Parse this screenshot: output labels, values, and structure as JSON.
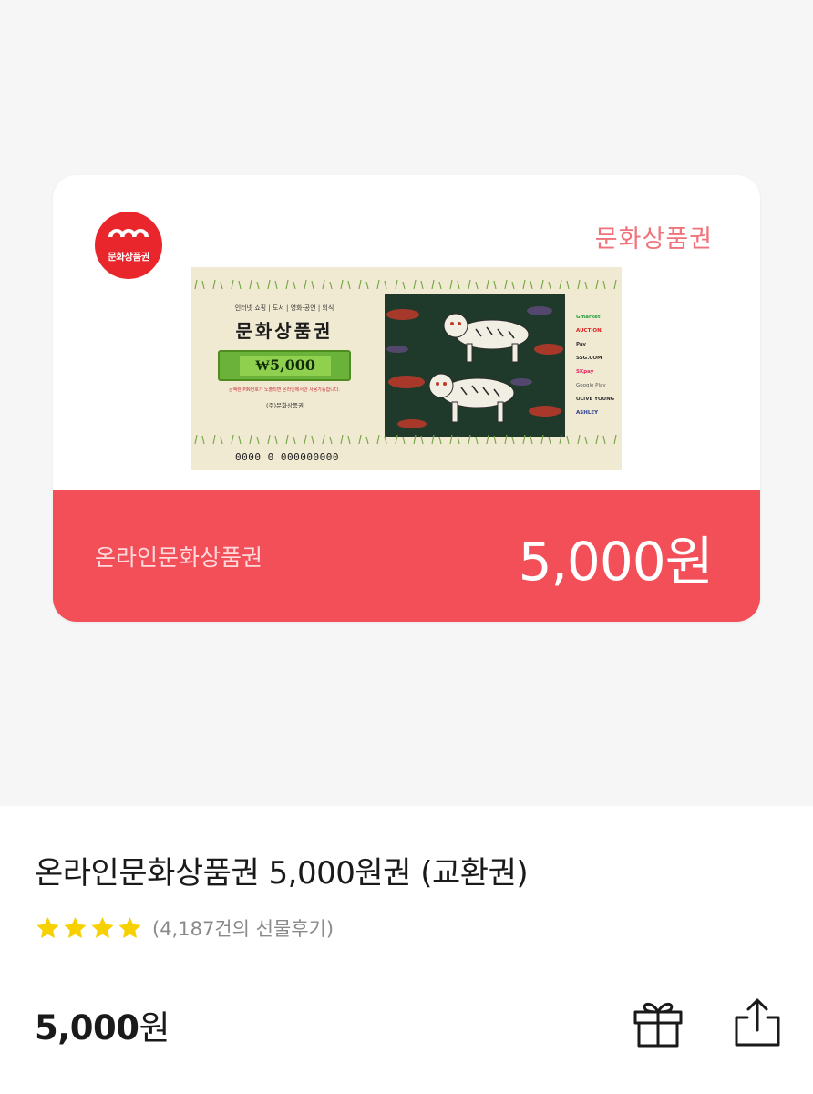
{
  "card": {
    "brand_logo_text": "문화상품권",
    "title": "문화상품권",
    "label": "온라인문화상품권",
    "amount": "5,000원",
    "voucher": {
      "uses": "인터넷 쇼핑 | 도서 | 영화·공연 | 외식",
      "title": "문화상품권",
      "amount": "₩5,000",
      "fine_print": "금액란 PIN번호가 노출되면 온라인에서만 사용가능합니다.",
      "issuer": "(주)문화상품권",
      "serial": "0000  0  000000000",
      "partners": [
        "Gmarket",
        "AUCTION.",
        "Pay",
        "SSG.COM",
        "SKpay",
        "Google Play",
        "OLIVE YOUNG",
        "ASHLEY"
      ]
    }
  },
  "product": {
    "title": "온라인문화상품권 5,000원권 (교환권)",
    "rating_stars": 4,
    "review_count": "(4,187건의 선물후기)",
    "price": "5,000",
    "price_unit": "원"
  },
  "actions": {
    "gift_icon": "gift-icon",
    "share_icon": "share-icon"
  },
  "colors": {
    "accent": "#f24f58",
    "star": "#f7d000"
  }
}
